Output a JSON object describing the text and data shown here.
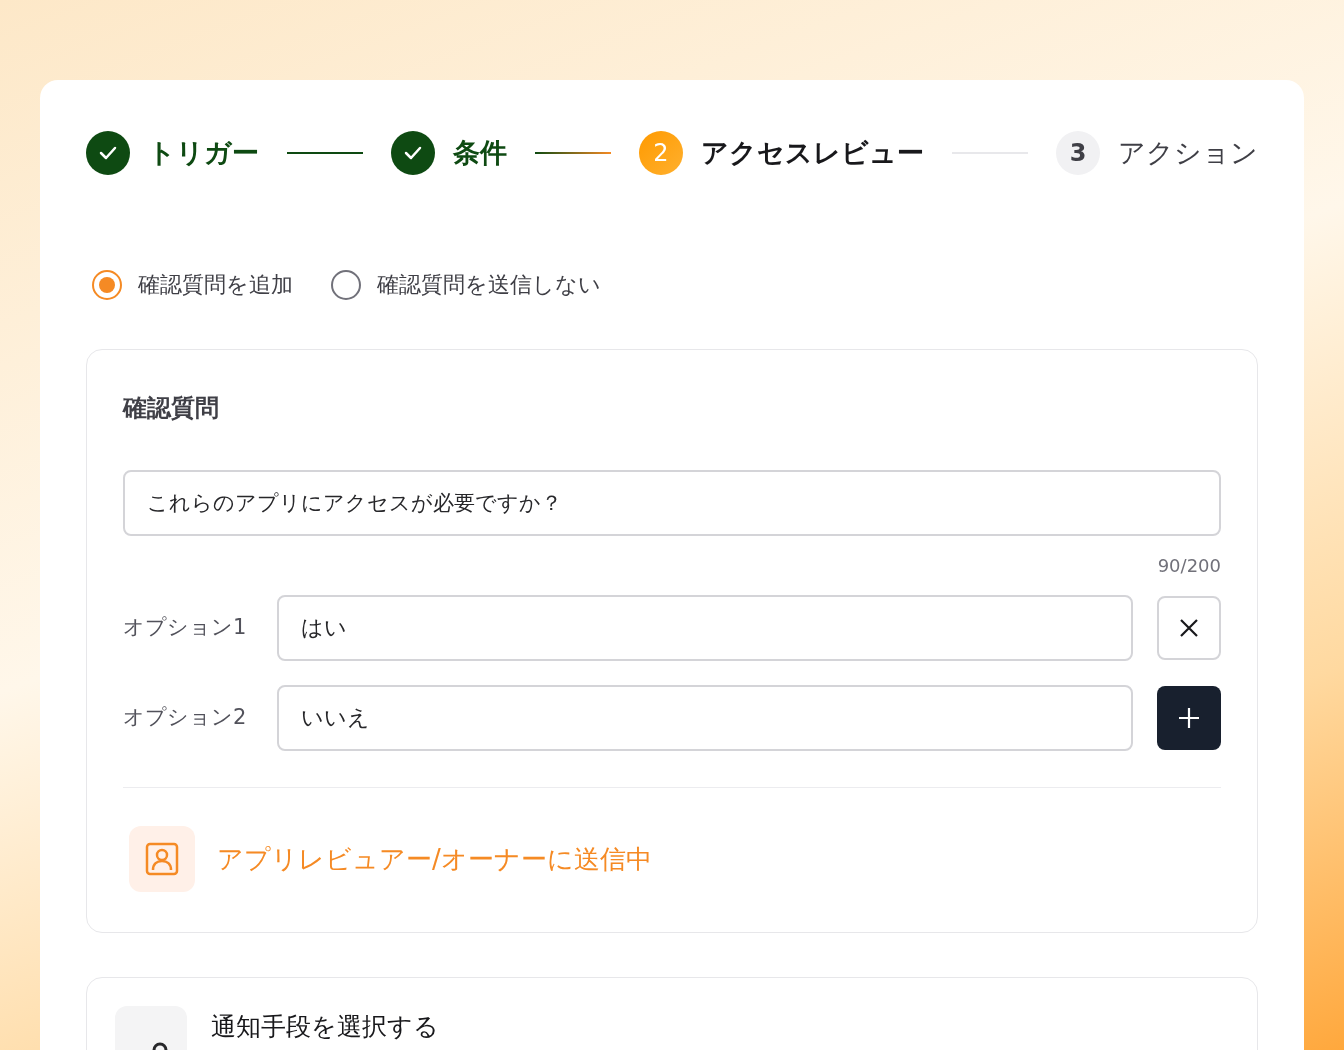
{
  "steps": [
    {
      "label": "トリガー",
      "kind": "done"
    },
    {
      "label": "条件",
      "kind": "done"
    },
    {
      "number": "2",
      "label": "アクセスレビュー",
      "kind": "current"
    },
    {
      "number": "3",
      "label": "アクション",
      "kind": "upcoming"
    }
  ],
  "radios": [
    {
      "label": "確認質問を追加",
      "selected": true
    },
    {
      "label": "確認質問を送信しない",
      "selected": false
    }
  ],
  "question_card": {
    "title": "確認質問",
    "question": "これらのアプリにアクセスが必要ですか？",
    "counter": "90/200",
    "options": [
      {
        "label": "オプション1",
        "value": "はい",
        "kind": "remove"
      },
      {
        "label": "オプション2",
        "value": "いいえ",
        "kind": "add"
      }
    ],
    "recipient": "アプリレビュアー/オーナーに送信中"
  },
  "notify_card": {
    "title": "通知手段を選択する"
  }
}
